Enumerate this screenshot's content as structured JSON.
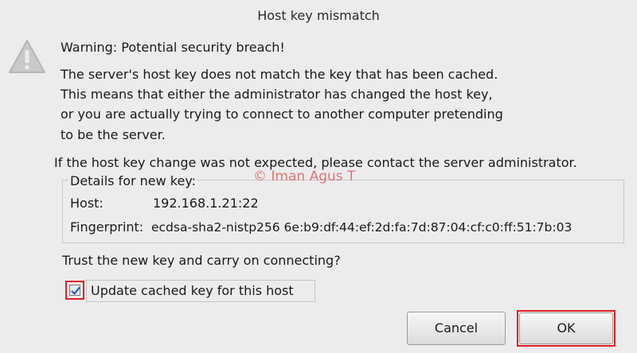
{
  "dialog": {
    "title": "Host key mismatch",
    "warning_heading": "Warning: Potential security breach!",
    "message_lines": [
      "The server's host key does not match the key that has been cached.",
      "This means that either the administrator has changed the host key,",
      "or you are actually trying to connect to another computer pretending",
      "to be the server."
    ],
    "contact_line": "If the host key change was not expected, please contact the server administrator.",
    "details": {
      "legend": "Details for new key:",
      "host_label": "Host:",
      "host_value": "192.168.1.21:22",
      "fingerprint_label": "Fingerprint:",
      "fingerprint_value": "ecdsa-sha2-nistp256 6e:b9:df:44:ef:2d:fa:7d:87:04:cf:c0:ff:51:7b:03"
    },
    "watermark": "© Iman Agus T",
    "trust_question": "Trust the new key and carry on connecting?",
    "checkbox": {
      "label": "Update cached key for this host",
      "checked": true
    },
    "buttons": {
      "cancel": "Cancel",
      "ok": "OK"
    }
  },
  "colors": {
    "highlight": "#e02020",
    "background": "#ececec"
  },
  "icons": {
    "warning": "warning-triangle-icon",
    "check": "checkmark-icon"
  }
}
